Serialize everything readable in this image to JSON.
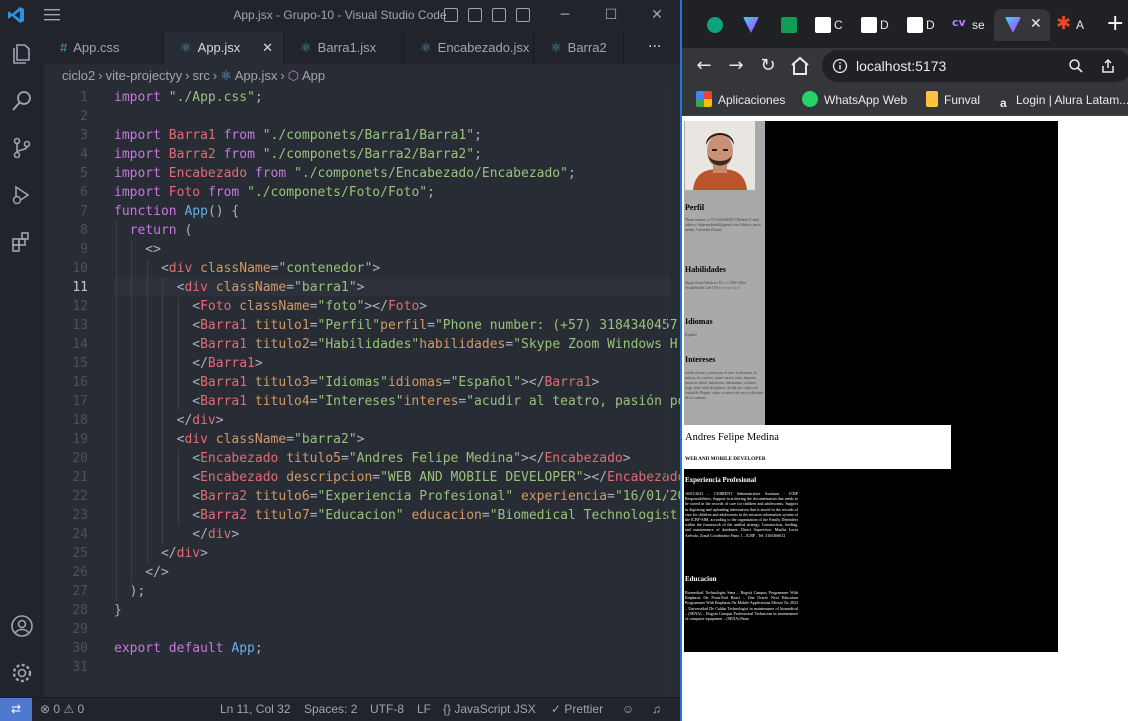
{
  "vscode": {
    "title": "App.jsx - Grupo-10 - Visual Studio Code",
    "tabs": [
      {
        "label": "App.css",
        "icon": "#"
      },
      {
        "label": "App.jsx",
        "icon": "⚛"
      },
      {
        "label": "Barra1.jsx",
        "icon": "⚛"
      },
      {
        "label": "Encabezado.jsx",
        "icon": "⚛"
      },
      {
        "label": "Barra2",
        "icon": "⚛"
      }
    ],
    "close_glyph": "✕",
    "more_glyph": "···",
    "breadcrumb": [
      "ciclo2",
      "vite-projectyy",
      "src",
      "App.jsx",
      "App"
    ],
    "current_line": 11,
    "status": {
      "remote": "⇄",
      "problems": "⊗ 0 ⚠ 0",
      "position": "Ln 11, Col 32",
      "spaces": "Spaces: 2",
      "encoding": "UTF-8",
      "eol": "LF",
      "language": "{} JavaScript JSX",
      "formatter": "✓ Prettier"
    }
  },
  "browser": {
    "tab_labels": [
      "C",
      "D",
      "D",
      "se",
      "A"
    ],
    "cv_label": "cv",
    "new_tab": "+",
    "url": "localhost:5173",
    "bookmarks": [
      "Aplicaciones",
      "WhatsApp Web",
      "Funval",
      "Login | Alura Latam..."
    ]
  },
  "cv": {
    "perfil_title": "Perfil",
    "perfil_text": "Phone number: (+57) 3184340457 (Mobile) E-mail address: felipemedina04@gmail.com Address: pasto, nariño, Colombia (Home)",
    "habilidades_title": "Habilidades",
    "habilidades_text": "Skype Zoom Windows H t r s CMS Office VisualStudioCode CSS j s r e a c t j s l",
    "idiomas_title": "Idiomas",
    "idiomas_text": "Español",
    "intereses_title": "Intereses",
    "intereses_text": "acudir al teatro, pasión por el cine, la literatura, la música, los cuentos, tomar cursos, tenis, deportes, practicar futbol, baloncesto, balonmano, ciclismo, yoga, entre otras disciplinas. Acudir por viajes a la ciudad de Bogotá, viajar a conocer de cerca y disfrutar de los culturas",
    "name": "Andres Felipe Medina",
    "description": "WEB AND MOBILE DEVELOPER",
    "experiencia_title": "Experiencia Profesional",
    "experiencia_text": "16/01/2023 – CURRENT Administrative Assistant - ICBF Responsibilities: Support in archiving the documentation that needs to be stored in the records of care for children and adolescents. Support in digitizing and uploading information that is stored in the records of care for children and adolescents in the mission information system of the ICBF-SIM, according to the organization of the Family Defenders within the framework of the unified strategy. Construction, feeding, and maintenance of databases. Direct Supervisor: Martha Lucia Arévalo, Zonal Coordinator Pasto 1 – ICBF . Tel: 3165466012",
    "educacion_title": "Educacion",
    "educacion_text": "Biomedical Technologist Sena – Bogotá Campus Programmer With Emphasis On Front-End React – One Oracle Next Education Programmer With Emphasis On Mobile Applications Mision Tic 2022 – Universidad De Caldas Technologist in maintenance of biomedical – (SENA) – Bogotá Campus Professional Technician in maintenance of computer equipment – (SENA) Pasto"
  },
  "colors": {
    "accent": "#1f78d1",
    "keyword": "#c678dd",
    "string": "#98c379",
    "tag": "#e06c75",
    "attribute": "#d19a66",
    "function": "#61afef"
  }
}
